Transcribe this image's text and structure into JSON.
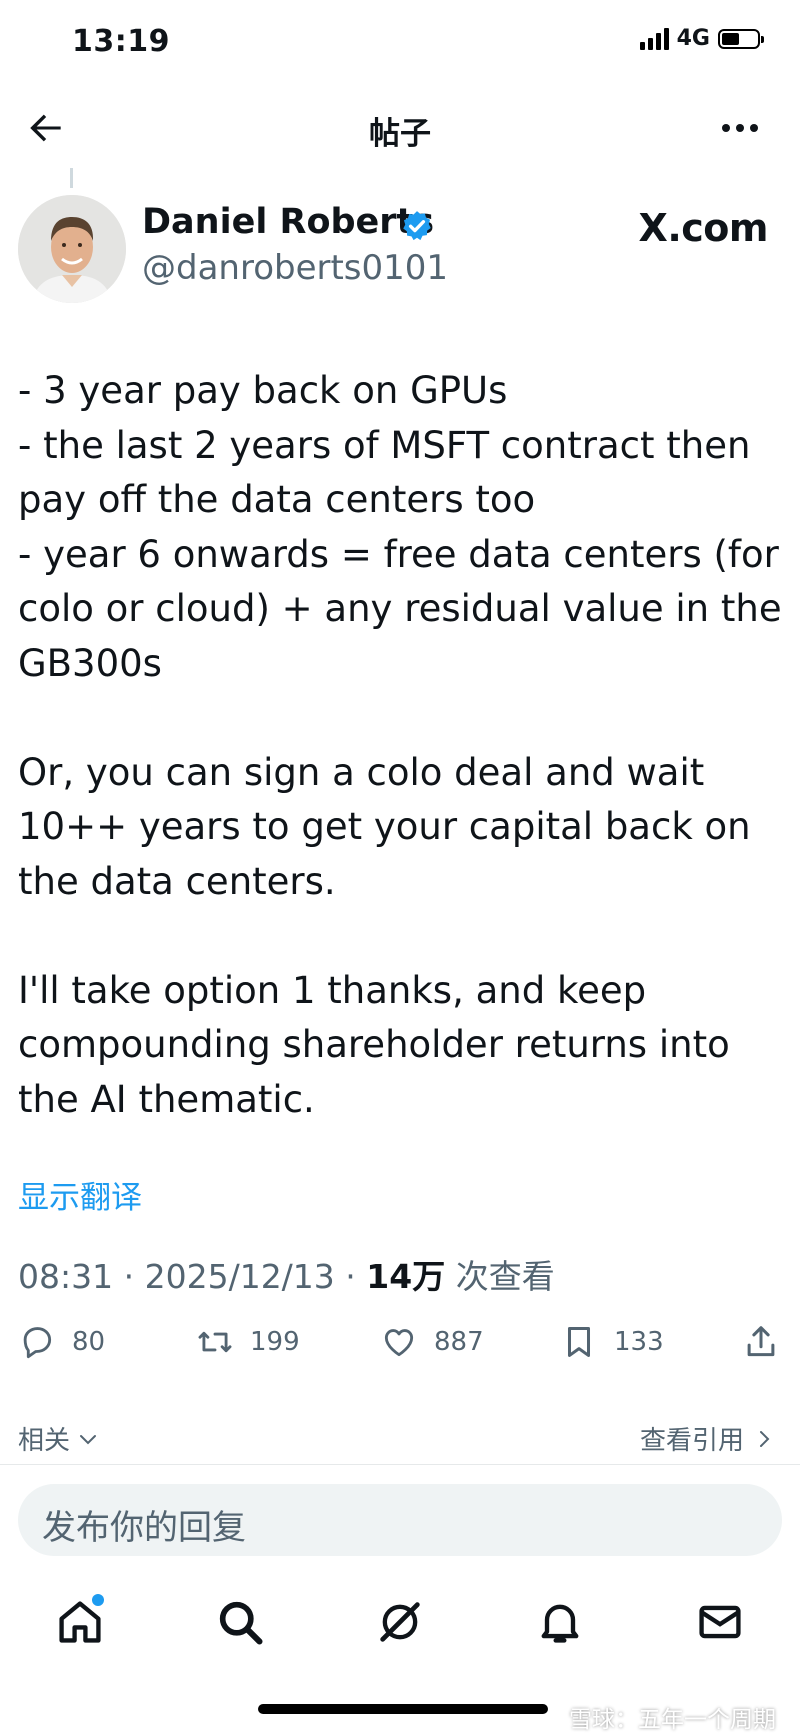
{
  "status_bar": {
    "time": "13:19",
    "network": "4G"
  },
  "header": {
    "title": "帖子"
  },
  "author": {
    "display_name": "Daniel Roberts",
    "handle": "@danroberts0101",
    "site_label": "X.com"
  },
  "tweet": {
    "paragraphs": [
      [
        "- 3 year pay back on GPUs",
        "- the last 2 years of MSFT contract then pay off the data centers too",
        "- year 6 onwards = free data centers (for colo or cloud) + any residual value in the GB300s"
      ],
      [
        "Or, you can sign a colo deal and wait 10++ years to get your capital back on the data centers."
      ],
      [
        "I'll take option 1 thanks, and keep compounding shareholder returns into the AI thematic."
      ]
    ],
    "line_1": "- 3 year pay back on GPUs",
    "line_2": "- the last 2 years of MSFT contract then pay off the data centers too",
    "line_3": "- year 6 onwards = free data centers (for colo or cloud) + any residual value in the GB300s",
    "para_2": "Or, you can sign a colo deal and wait 10++ years to get your capital back on the data centers.",
    "para_3": "I'll take option 1 thanks, and keep compounding shareholder returns into the AI thematic.",
    "translate_label": "显示翻译",
    "time": "08:31",
    "date": "2025/12/13",
    "views_count": "14万",
    "views_label": "次查看"
  },
  "actions": {
    "replies": "80",
    "reposts": "199",
    "likes": "887",
    "bookmarks": "133"
  },
  "related_label": "相关",
  "view_quotes_label": "查看引用",
  "reply_placeholder": "发布你的回复",
  "watermark": "雪球：五年一个周期",
  "colors": {
    "accent": "#1d9bf0",
    "text": "#0f1419",
    "secondary": "#536471"
  }
}
